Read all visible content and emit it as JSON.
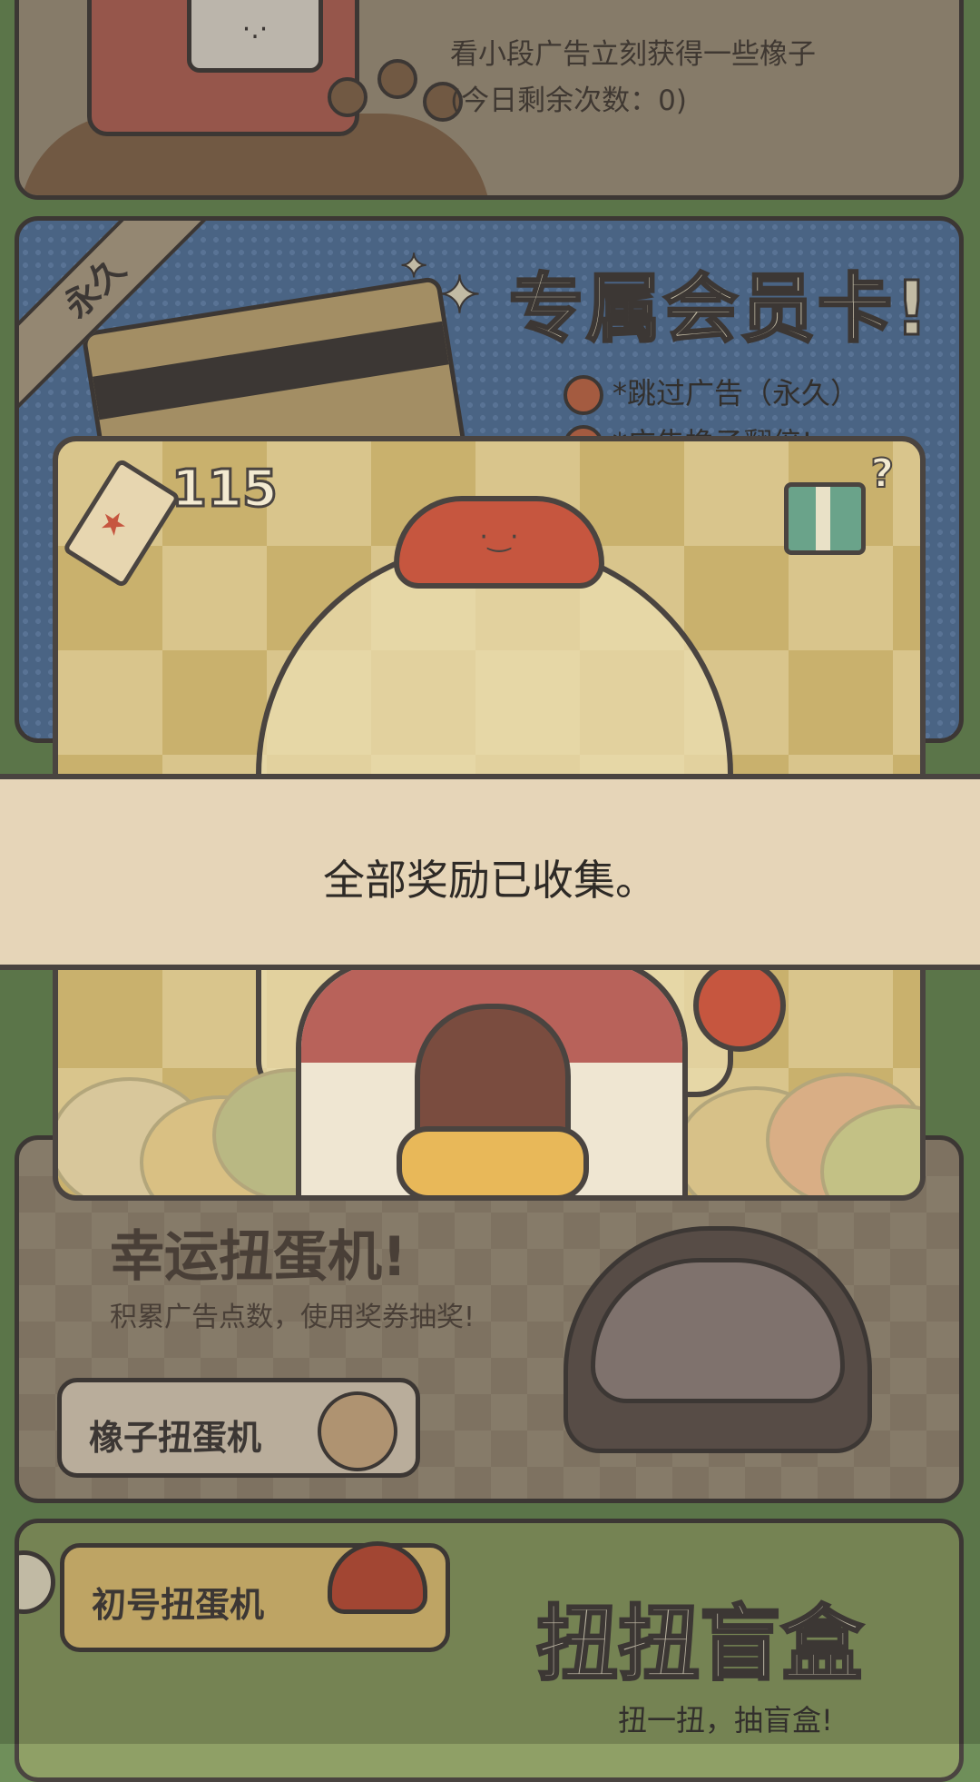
{
  "ad_card": {
    "robot_face": "·.·",
    "description": "看小段广告立刻获得一些橡子",
    "remaining": "(今日剩余次数：0)"
  },
  "vip_card": {
    "ribbon": "永久",
    "title": "专属会员卡!",
    "features": [
      "*跳过广告（永久）",
      "*广告橡子翻倍!"
    ]
  },
  "popup": {
    "ticket_count": "115",
    "gift_mark": "?",
    "cap_face": "·‿·"
  },
  "toast": {
    "message": "全部奖励已收集。"
  },
  "gacha_card": {
    "title": "幸运扭蛋机!",
    "subtitle": "积累广告点数，使用奖券抽奖!",
    "button": "橡子扭蛋机"
  },
  "blind_card": {
    "button": "初号扭蛋机",
    "title": "扭扭盲盒",
    "subtitle": "扭一扭，抽盲盒!"
  },
  "colors": {
    "background": "#6f8f5a",
    "outline": "#4a4440",
    "toast": "#e6d5b8",
    "accent_red": "#c6563f"
  }
}
